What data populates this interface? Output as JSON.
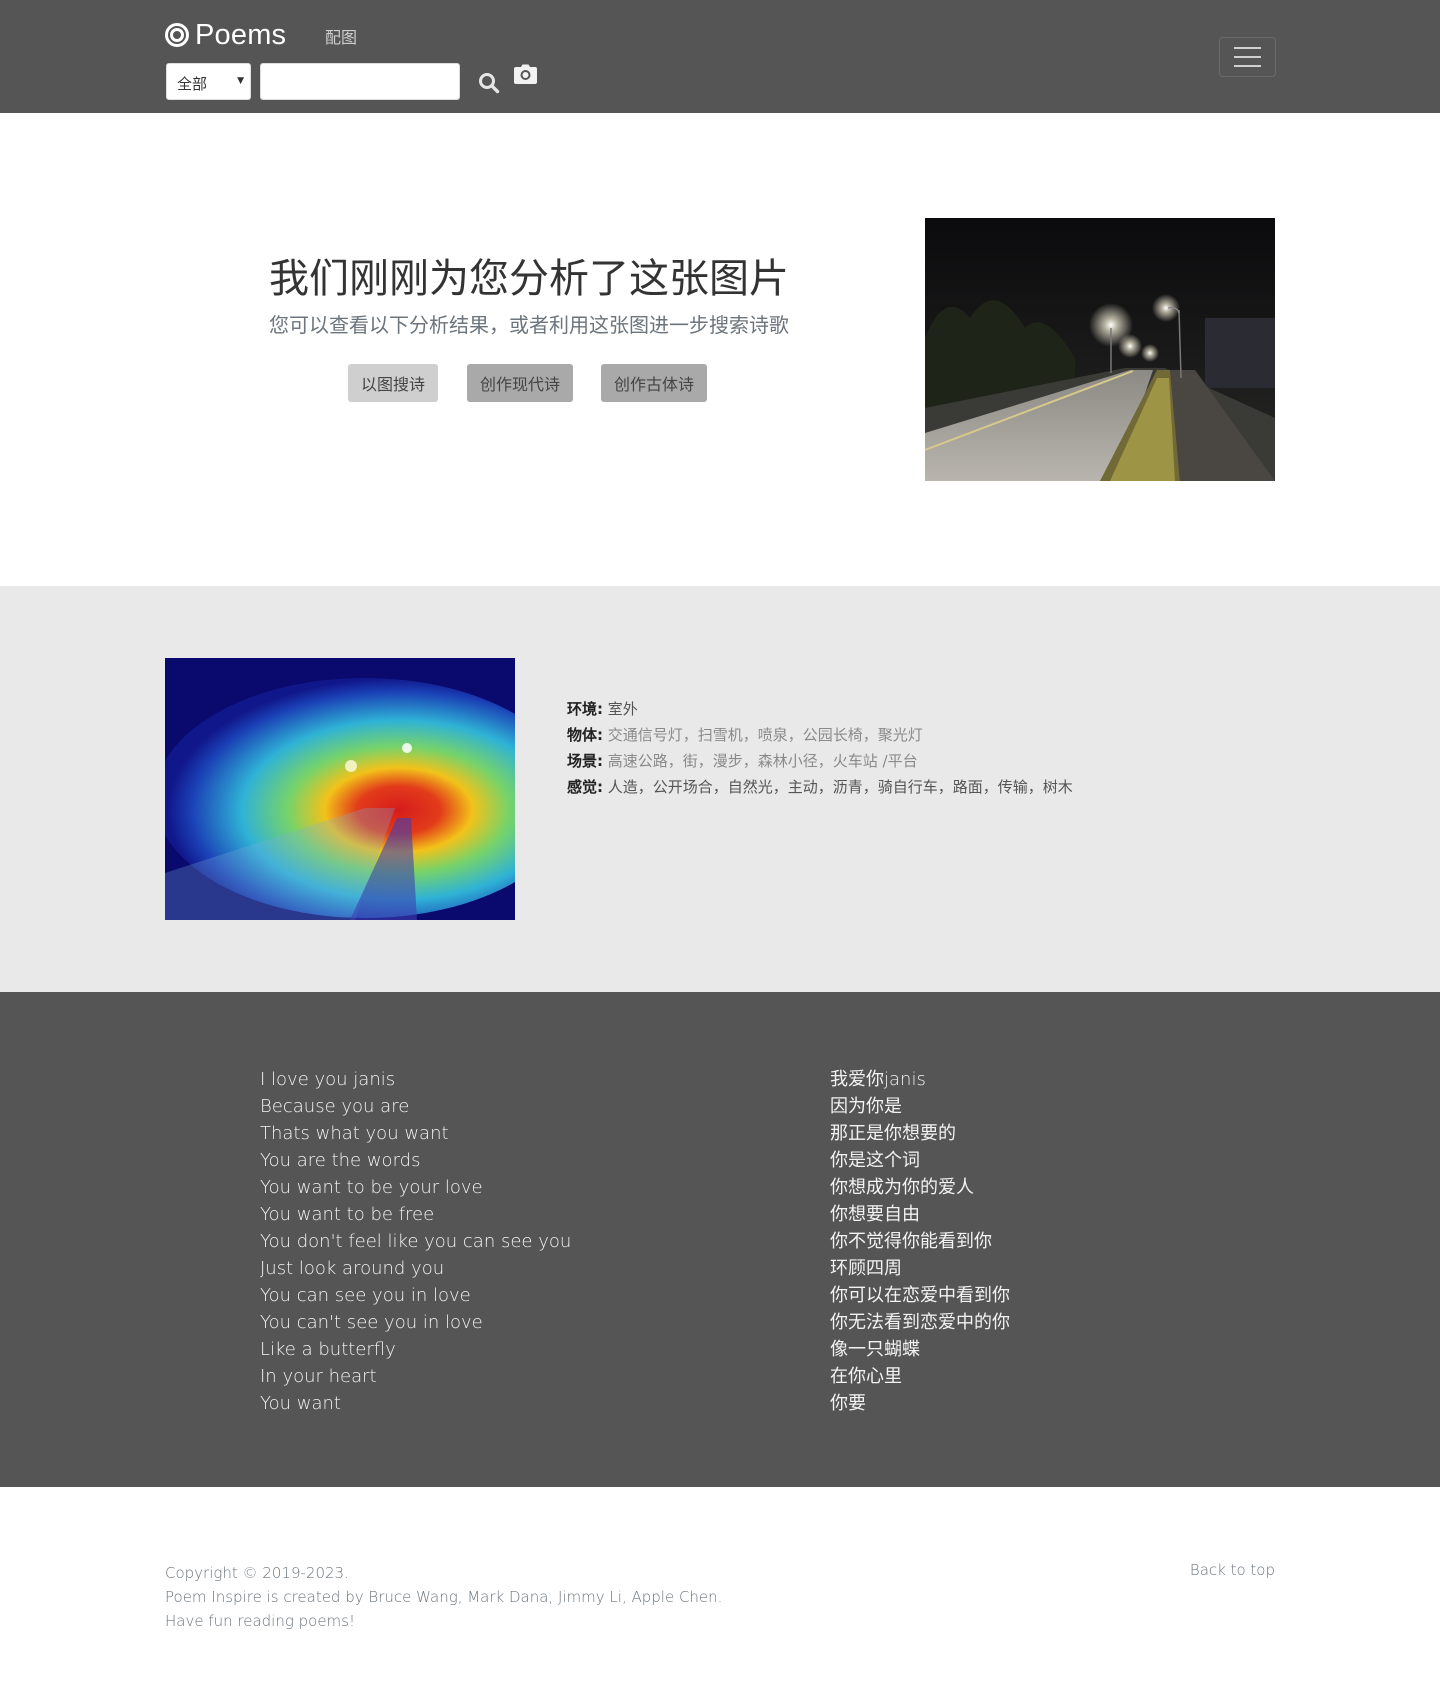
{
  "navbar": {
    "brand": "Poems",
    "link": "配图",
    "select_value": "全部",
    "search_value": "",
    "colors": {
      "background": "#555555"
    }
  },
  "hero": {
    "title": "我们刚刚为您分析了这张图片",
    "subtitle": "您可以查看以下分析结果，或者利用这张图进一步搜索诗歌",
    "buttons": [
      "以图搜诗",
      "创作现代诗",
      "创作古体诗"
    ]
  },
  "analysis": {
    "rows": [
      {
        "key": "环境:",
        "value": "室外"
      },
      {
        "key": "物体:",
        "value": "交通信号灯，扫雪机，喷泉，公园长椅，聚光灯"
      },
      {
        "key": "场景:",
        "value": "高速公路，街，漫步，森林小径，火车站 /平台"
      },
      {
        "key": "感觉:",
        "value": "人造，公开场合，自然光，主动，沥青，骑自行车，路面，传输，树木"
      }
    ]
  },
  "poem": {
    "english": [
      "I love you janis",
      "Because you are",
      "Thats what you want",
      "You are the words",
      "You want to be your love",
      "You want to be free",
      "You don't feel like you can see you",
      "Just look around you",
      "You can see you in love",
      "You can't see you in love",
      "Like a butterfly",
      "In your heart",
      "You want"
    ],
    "chinese": [
      "我爱你janis",
      "因为你是",
      "那正是你想要的",
      "你是这个词",
      "你想成为你的爱人",
      "你想要自由",
      "你不觉得你能看到你",
      "环顾四周",
      "你可以在恋爱中看到你",
      "你无法看到恋爱中的你",
      "像一只蝴蝶",
      "在你心里",
      "你要"
    ]
  },
  "footer": {
    "copyright": "Copyright © 2019-2023.",
    "credits": "Poem Inspire is created by Bruce Wang, Mark Dana, Jimmy Li, Apple Chen.",
    "tagline": "Have fun reading poems!",
    "back_to_top": "Back to top"
  }
}
